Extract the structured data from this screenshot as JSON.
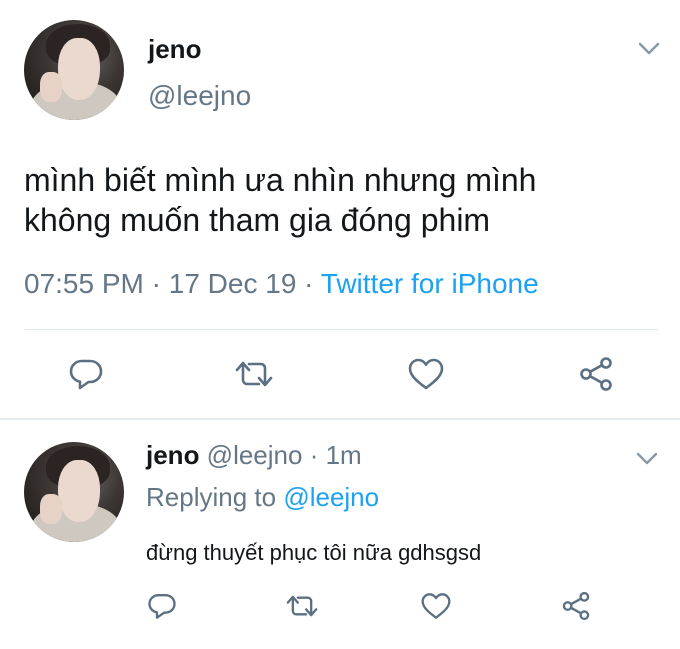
{
  "main_tweet": {
    "display_name": "jeno",
    "handle": "@leejno",
    "text_line1": "mình biết mình ưa nhìn nhưng mình",
    "text_line2": "không muốn tham gia đóng phim",
    "time": "07:55 PM",
    "sep1": " · ",
    "date": "17 Dec 19",
    "sep2": " · ",
    "source": "Twitter for iPhone",
    "actions": [
      "reply-icon",
      "retweet-icon",
      "like-icon",
      "share-icon"
    ]
  },
  "reply_tweet": {
    "display_name": "jeno",
    "handle": " @leejno",
    "dot": " · ",
    "age": "1m",
    "replying_label": "Replying to ",
    "replying_to": "@leejno",
    "text": "đừng thuyết phục tôi nữa gdhsgsd",
    "actions": [
      "reply-icon",
      "retweet-icon",
      "like-icon",
      "share-icon"
    ]
  },
  "colors": {
    "primary_text": "#14171a",
    "secondary_text": "#657786",
    "link": "#1da1f2",
    "icon": "#5b7083",
    "divider": "#e1e8ed"
  }
}
